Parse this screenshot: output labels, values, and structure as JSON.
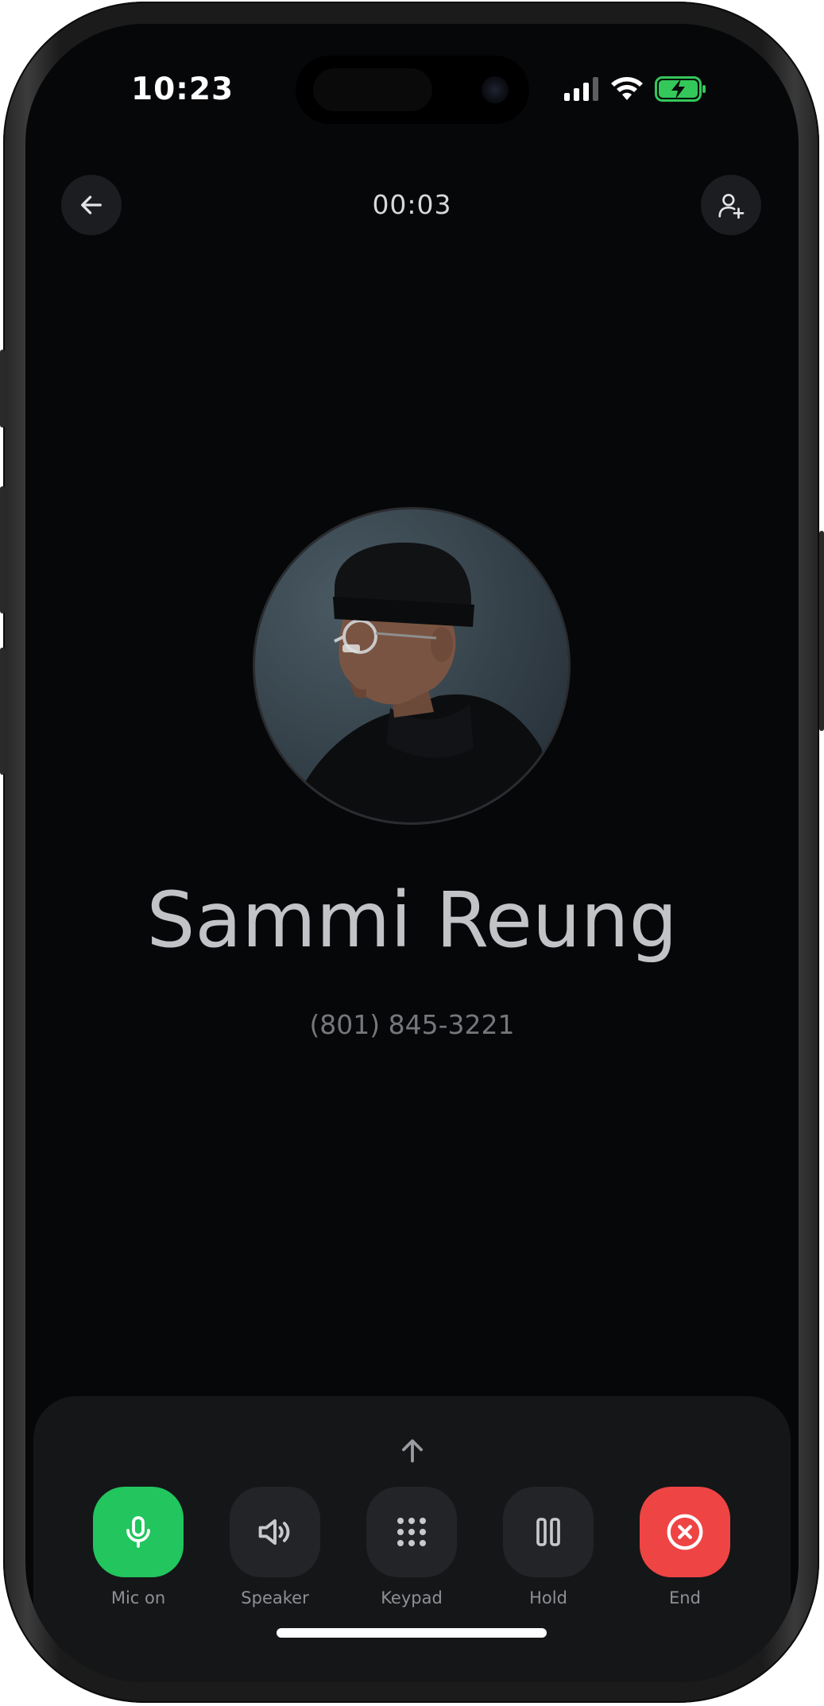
{
  "status_bar": {
    "time": "10:23",
    "icons": [
      "cellular-signal-icon",
      "wifi-icon",
      "battery-charging-icon"
    ],
    "battery_color": "#34c759"
  },
  "call": {
    "duration": "00:03",
    "contact_name": "Sammi Reung",
    "contact_number": "(801) 845-3221"
  },
  "top_bar": {
    "back_icon": "arrow-left-icon",
    "add_contact_icon": "person-add-icon"
  },
  "controls": [
    {
      "label": "Mic on",
      "icon": "microphone-icon",
      "color": "#22c55e"
    },
    {
      "label": "Speaker",
      "icon": "speaker-icon",
      "color": "#232427"
    },
    {
      "label": "Keypad",
      "icon": "keypad-icon",
      "color": "#232427"
    },
    {
      "label": "Hold",
      "icon": "pause-icon",
      "color": "#232427"
    },
    {
      "label": "End",
      "icon": "close-circle-icon",
      "color": "#ef4444"
    }
  ],
  "panel": {
    "expand_icon": "arrow-up-icon"
  }
}
